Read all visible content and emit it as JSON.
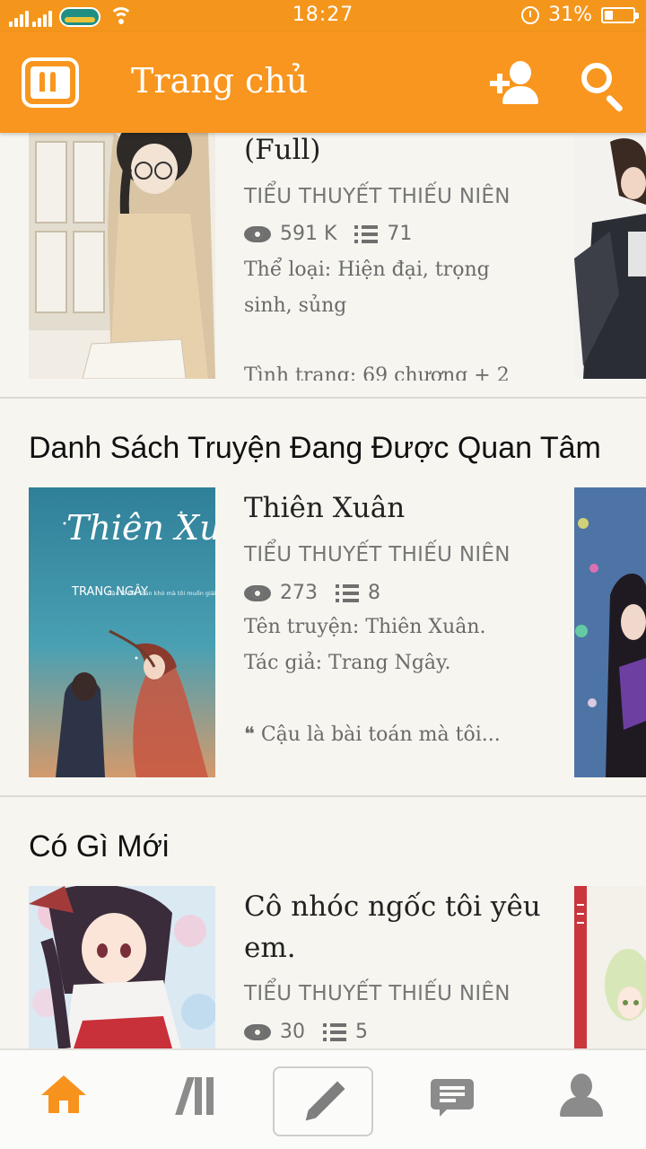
{
  "status_bar": {
    "carrier": "VIETTEL",
    "time": "18:27",
    "battery": "31%",
    "battery_level": 0.31
  },
  "app_bar": {
    "title": "Trang chủ",
    "icons": [
      "wattpad-logo-icon",
      "add-user-icon",
      "search-icon"
    ]
  },
  "top_book": {
    "title": "(Full)",
    "category": "TIỂU THUYẾT THIẾU NIÊN",
    "views": "591 K",
    "chapters": "71",
    "desc_line_1": "Thể loại: Hiện đại, trọng",
    "desc_line_2": "sinh, sủng",
    "desc_line_3": "Tình trạng: 69 chương + 2"
  },
  "section_trending": {
    "heading": "Danh Sách Truyện Đang Được Quan Tâm",
    "book": {
      "cover_title": "Thiên Xuân",
      "cover_author": "TRANG NGÂY",
      "cover_quote": "Cậu là bài Toán khó mà tôi muốn giải, chỉ cần không vô nghiệm, kết quả ra sao tôi cũng chấp nhận.",
      "title": "Thiên Xuân",
      "category": "TIỂU THUYẾT THIẾU NIÊN",
      "views": "273",
      "chapters": "8",
      "desc_line_1": "Tên truyện: Thiên Xuân.",
      "desc_line_2": "Tác giả: Trang Ngây.",
      "desc_line_3": "❝ Cậu là bài toán mà tôi..."
    }
  },
  "section_new": {
    "heading": "Có Gì Mới",
    "book": {
      "title_line_1": "Cô nhóc ngốc tôi yêu",
      "title_line_2": "em.",
      "category": "TIỂU THUYẾT THIẾU NIÊN",
      "views": "30",
      "chapters": "5"
    }
  },
  "bottom_nav": {
    "items": [
      "home-icon",
      "library-icon",
      "write-icon",
      "messages-icon",
      "profile-icon"
    ],
    "active_color": "#f7931d"
  },
  "colors": {
    "brand_orange": "#f8961f",
    "background": "#f6f5f0"
  }
}
